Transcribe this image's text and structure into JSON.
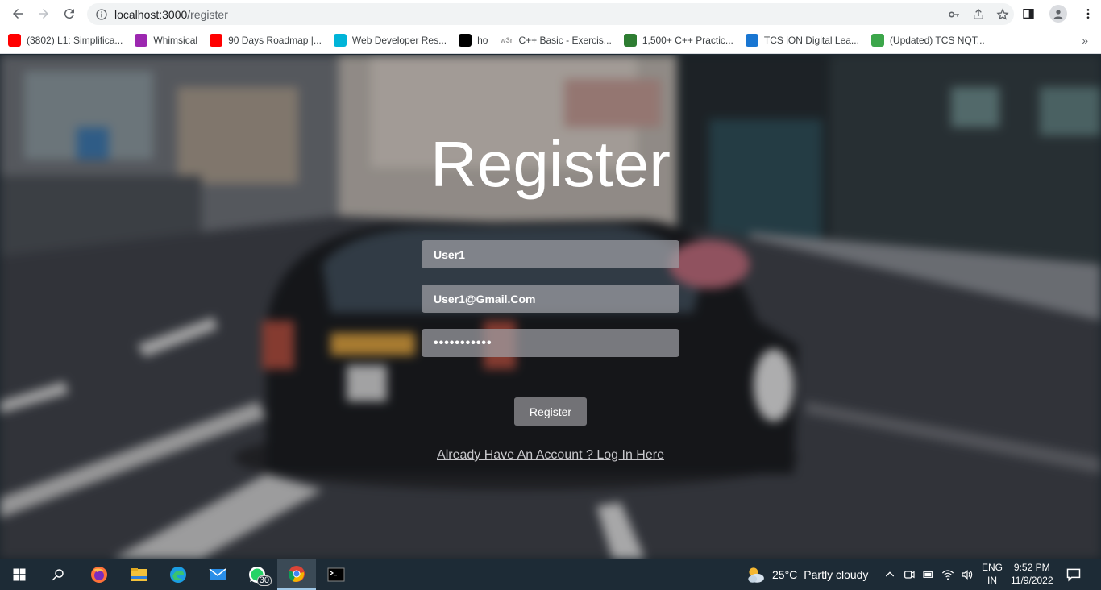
{
  "browser": {
    "url_host": "localhost:3000",
    "url_path": "/register"
  },
  "bookmarks": [
    {
      "label": "(3802) L1: Simplifica...",
      "icon": "youtube-icon",
      "color": "#ff0000"
    },
    {
      "label": "Whimsical",
      "icon": "whimsical-icon",
      "color": "#9c27b0"
    },
    {
      "label": "90 Days Roadmap |...",
      "icon": "youtube-icon",
      "color": "#ff0000"
    },
    {
      "label": "Web Developer Res...",
      "icon": "n-logo-icon",
      "color": "#00b4d8"
    },
    {
      "label": "ho",
      "icon": "hackerrank-icon",
      "color": "#000000"
    },
    {
      "label": "C++ Basic - Exercis...",
      "icon": "w3r-icon",
      "color": "#999999"
    },
    {
      "label": "1,500+ C++ Practic...",
      "icon": "owl-icon",
      "color": "#2e7d32"
    },
    {
      "label": "TCS iON Digital Lea...",
      "icon": "power-icon",
      "color": "#1976d2"
    },
    {
      "label": "(Updated) TCS NQT...",
      "icon": "play-icon",
      "color": "#3ca64a"
    }
  ],
  "page": {
    "title": "Register",
    "username_value": "User1",
    "email_value": "User1@Gmail.Com",
    "password_value": "•••••••••••",
    "register_button": "Register",
    "login_link": "Already Have An Account ? Log In Here"
  },
  "taskbar": {
    "whatsapp_badge": "30",
    "weather_temp": "25°C",
    "weather_desc": "Partly cloudy",
    "lang_line1": "ENG",
    "lang_line2": "IN",
    "time": "9:52 PM",
    "date": "11/9/2022"
  }
}
